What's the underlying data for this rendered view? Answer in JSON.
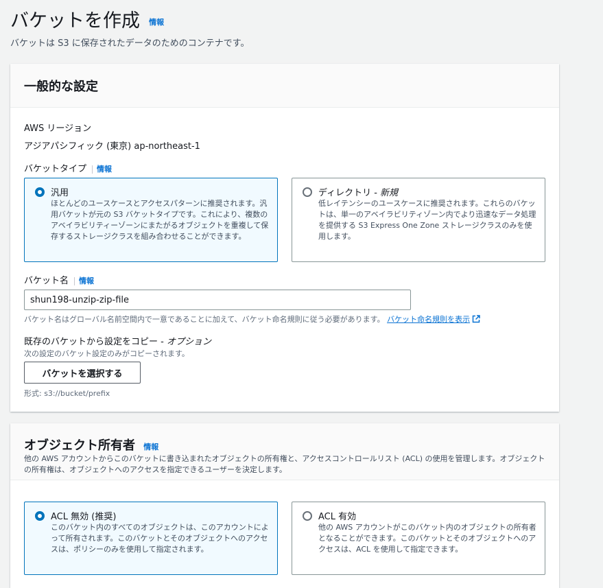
{
  "page": {
    "title": "バケットを作成",
    "info": "情報",
    "description": "バケットは S3 に保存されたデータのためのコンテナです。"
  },
  "general": {
    "title": "一般的な設定",
    "region_label": "AWS リージョン",
    "region_value": "アジアパシフィック (東京) ap-northeast-1",
    "bucket_type_label": "バケットタイプ",
    "info": "情報",
    "bucket_types": [
      {
        "title": "汎用",
        "badge": "",
        "description": "ほとんどのユースケースとアクセスパターンに推奨されます。汎用バケットが元の S3 バケットタイプです。これにより、複数のアベイラビリティーゾーンにまたがるオブジェクトを重複して保存するストレージクラスを組み合わせることができます。",
        "selected": true
      },
      {
        "title": "ディレクトリ - ",
        "badge": "新規",
        "description": "低レイテンシーのユースケースに推奨されます。これらのバケットは、単一のアベイラビリティゾーン内でより迅速なデータ処理を提供する S3 Express One Zone ストレージクラスのみを使用します。",
        "selected": false
      }
    ],
    "bucket_name_label": "バケット名",
    "bucket_name_value": "shun198-unzip-zip-file",
    "bucket_name_hint": "バケット名はグローバル名前空間内で一意であることに加えて、バケット命名規則に従う必要があります。",
    "bucket_name_link": "バケット命名規則を表示",
    "copy_label": "既存のバケットから設定をコピー - ",
    "copy_optional": "オプション",
    "copy_hint": "次の設定のバケット設定のみがコピーされます。",
    "choose_button": "バケットを選択する",
    "format_hint": "形式: s3://bucket/prefix"
  },
  "ownership": {
    "title": "オブジェクト所有者",
    "info": "情報",
    "description": "他の AWS アカウントからこのバケットに書き込まれたオブジェクトの所有権と、アクセスコントロールリスト (ACL) の使用を管理します。オブジェクトの所有権は、オブジェクトへのアクセスを指定できるユーザーを決定します。",
    "options": [
      {
        "title": "ACL 無効 (推奨)",
        "description": "このバケット内のすべてのオブジェクトは、このアカウントによって所有されます。このバケットとそのオブジェクトへのアクセスは、ポリシーのみを使用して指定されます。",
        "selected": true
      },
      {
        "title": "ACL 有効",
        "description": "他の AWS アカウントがこのバケット内のオブジェクトの所有者となることができます。このバケットとそのオブジェクトへのアクセスは、ACL を使用して指定できます。",
        "selected": false
      }
    ]
  },
  "colors": {
    "link": "#0972d3",
    "selected_border": "#0073bb",
    "selected_background": "#f1faff",
    "page_background": "#f2f3f3"
  }
}
